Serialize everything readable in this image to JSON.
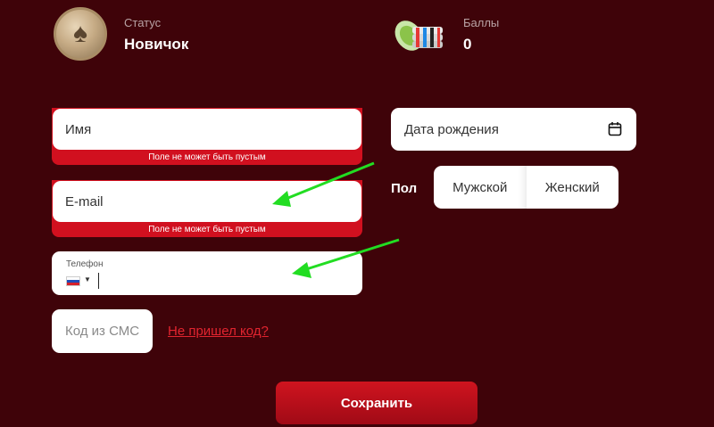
{
  "header": {
    "status_label": "Статус",
    "status_value": "Новичок",
    "points_label": "Баллы",
    "points_value": "0"
  },
  "form": {
    "name": {
      "placeholder": "Имя",
      "error": "Поле не может быть пустым"
    },
    "email": {
      "placeholder": "E-mail",
      "error": "Поле не может быть пустым"
    },
    "phone": {
      "label": "Телефон",
      "value": "",
      "country_flag": "russia-flag-icon"
    },
    "sms": {
      "placeholder": "Код из СМС",
      "resend_link": "Не пришел код?"
    },
    "dob": {
      "placeholder": "Дата рождения",
      "icon": "calendar-icon"
    },
    "gender": {
      "label": "Пол",
      "options": [
        "Мужской",
        "Женский"
      ]
    },
    "save_label": "Сохранить"
  },
  "colors": {
    "background": "#3f0309",
    "accent": "#d0141f",
    "error": "#d1101f",
    "arrow": "#22dd22"
  }
}
